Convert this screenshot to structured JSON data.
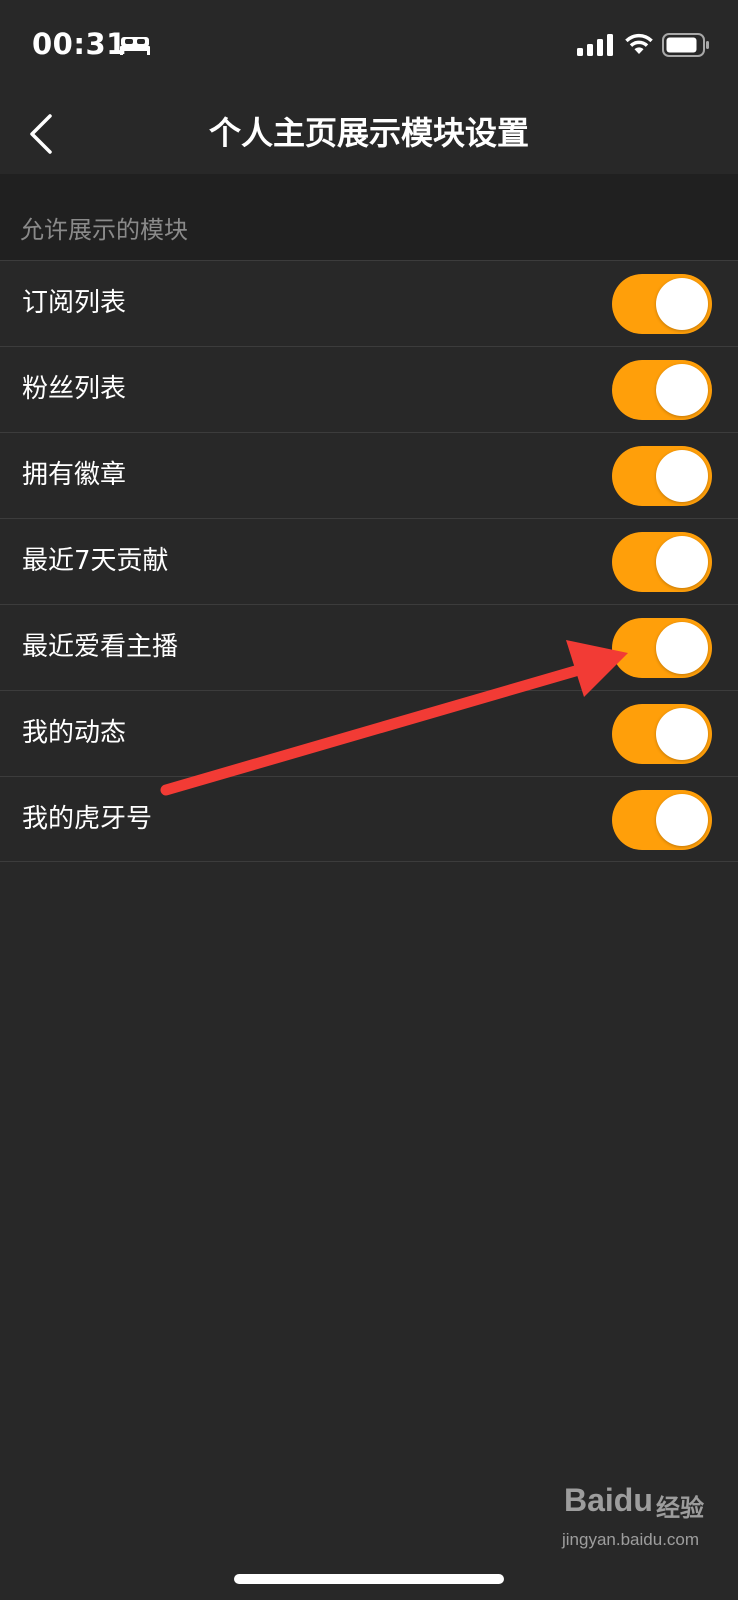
{
  "status_bar": {
    "time": "00:31",
    "sleep_icon": "bed-icon",
    "signal_icon": "cellular-signal-icon",
    "wifi_icon": "wifi-icon",
    "battery_icon": "battery-icon"
  },
  "nav": {
    "back_icon": "chevron-left-icon",
    "title": "个人主页展示模块设置"
  },
  "section": {
    "label": "允许展示的模块"
  },
  "modules": [
    {
      "label": "订阅列表",
      "enabled": true
    },
    {
      "label": "粉丝列表",
      "enabled": true
    },
    {
      "label": "拥有徽章",
      "enabled": true
    },
    {
      "label": "最近7天贡献",
      "enabled": true
    },
    {
      "label": "最近爱看主播",
      "enabled": true
    },
    {
      "label": "我的动态",
      "enabled": true
    },
    {
      "label": "我的虎牙号",
      "enabled": true
    }
  ],
  "watermark": {
    "brand": "Baidu",
    "brand_cn": "经验",
    "url": "jingyan.baidu.com"
  },
  "colors": {
    "background": "#282828",
    "section_background": "#202020",
    "toggle_on": "#ff9f0a",
    "annotation_arrow": "#f23b35"
  }
}
